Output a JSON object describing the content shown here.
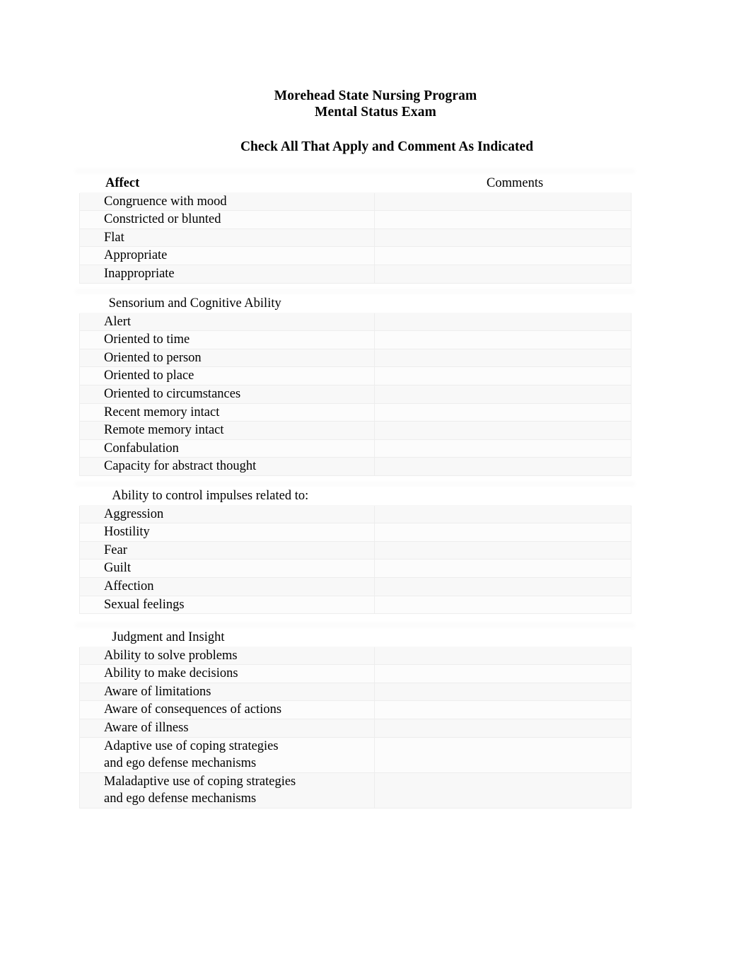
{
  "document": {
    "title_line_1": "Morehead State Nursing Program",
    "title_line_2": "Mental Status Exam",
    "instruction": "Check All That Apply and Comment As Indicated",
    "comments_column_header": "Comments"
  },
  "sections": [
    {
      "heading": "Affect",
      "heading_bold": true,
      "items": [
        "Congruence with mood",
        "Constricted or blunted",
        "Flat",
        "Appropriate",
        "Inappropriate"
      ]
    },
    {
      "heading": " Sensorium and Cognitive Ability",
      "heading_bold": false,
      "items": [
        "Alert",
        "Oriented to time",
        "Oriented to person",
        "Oriented to place",
        "Oriented to circumstances",
        "Recent memory intact",
        "Remote memory intact",
        "Confabulation",
        "Capacity for abstract thought"
      ]
    },
    {
      "heading": "  Ability to control impulses related to:",
      "heading_bold": false,
      "items": [
        "Aggression",
        "Hostility",
        "Fear",
        "Guilt",
        "Affection",
        "Sexual feelings"
      ]
    },
    {
      "heading": "  Judgment and Insight",
      "heading_bold": false,
      "items": [
        "Ability to solve problems",
        "Ability to make decisions",
        "Aware of limitations",
        "Aware of consequences of actions",
        "Aware of illness",
        "Adaptive use of coping strategies\nand ego defense mechanisms",
        "Maladaptive use of coping strategies\nand ego defense mechanisms"
      ]
    }
  ],
  "layout": {
    "section_tops": [
      246,
      416,
      688,
      888
    ],
    "border_color": "#ededed",
    "text_color": "#000000",
    "page_background": "#ffffff"
  }
}
